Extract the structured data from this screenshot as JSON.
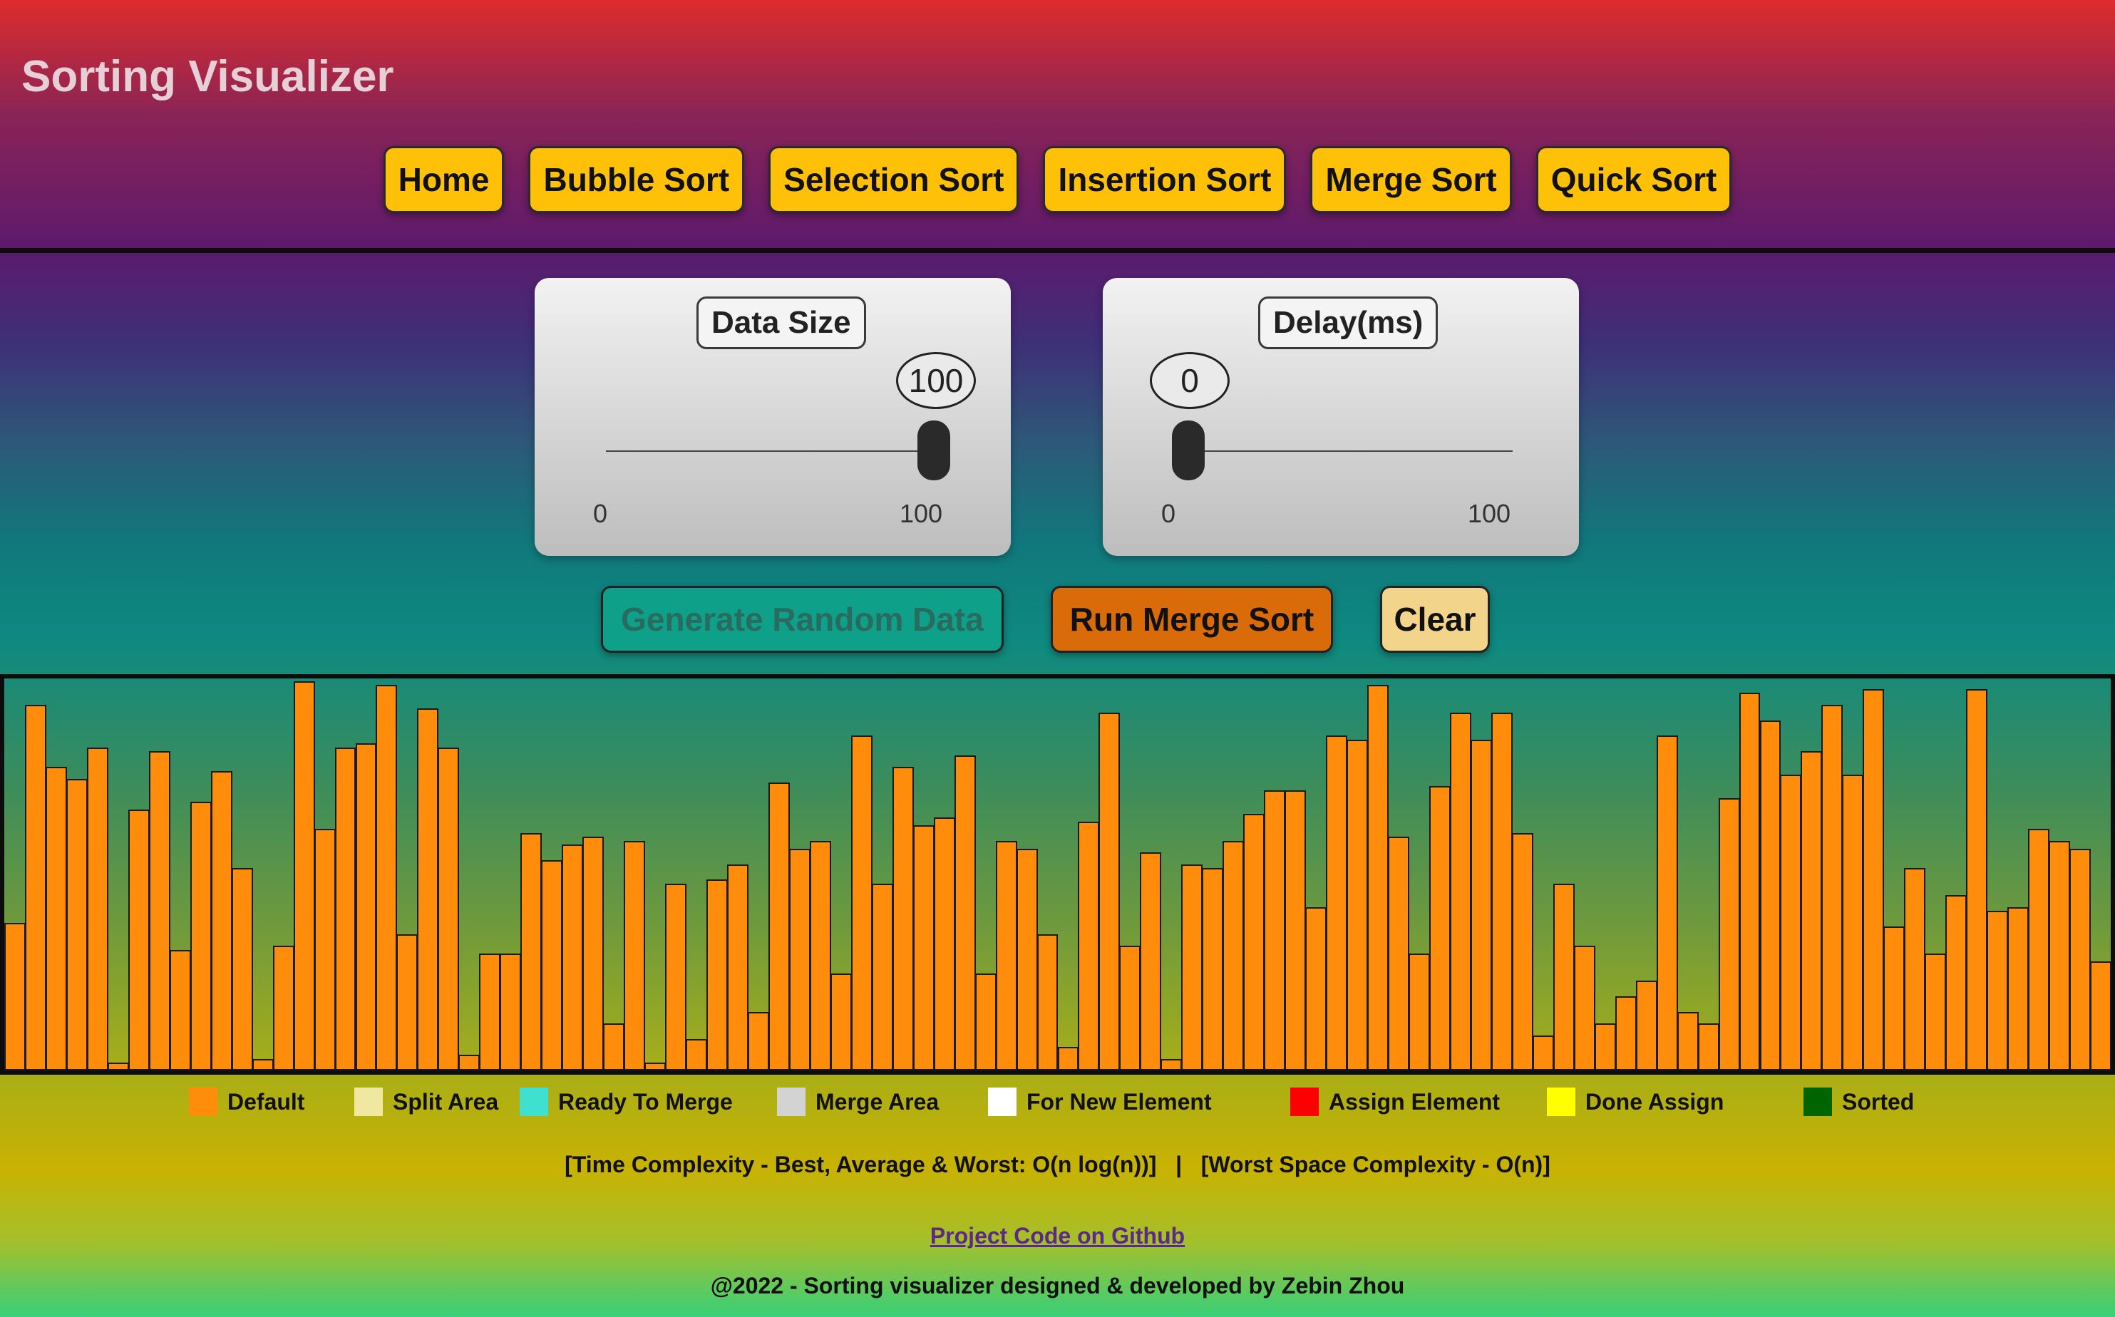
{
  "app": {
    "title": "Sorting Visualizer"
  },
  "nav": [
    {
      "label": "Home"
    },
    {
      "label": "Bubble Sort"
    },
    {
      "label": "Selection Sort"
    },
    {
      "label": "Insertion Sort"
    },
    {
      "label": "Merge Sort"
    },
    {
      "label": "Quick Sort"
    }
  ],
  "controls": {
    "data_size": {
      "label": "Data Size",
      "value": "100",
      "min": "0",
      "max": "100",
      "fraction": 1.0
    },
    "delay": {
      "label": "Delay(ms)",
      "value": "0",
      "min": "0",
      "max": "100",
      "fraction": 0.0
    }
  },
  "actions": {
    "generate": {
      "label": "Generate Random Data",
      "bg": "#0fa08a",
      "color": "#2a6b60"
    },
    "run": {
      "label": "Run Merge Sort",
      "bg": "#d96c08",
      "color": "#111111"
    },
    "clear": {
      "label": "Clear",
      "bg": "#f2d58a",
      "color": "#111111"
    }
  },
  "bars": {
    "color": "#ff8c0a",
    "values": [
      38,
      94,
      78,
      75,
      83,
      2,
      67,
      82,
      31,
      69,
      77,
      52,
      3,
      32,
      100,
      62,
      83,
      84,
      99,
      35,
      93,
      83,
      4,
      30,
      30,
      61,
      54,
      58,
      60,
      12,
      59,
      2,
      48,
      8,
      49,
      53,
      15,
      74,
      57,
      59,
      25,
      86,
      48,
      78,
      63,
      65,
      81,
      25,
      59,
      57,
      35,
      6,
      64,
      92,
      32,
      56,
      3,
      53,
      52,
      59,
      66,
      72,
      72,
      42,
      86,
      85,
      99,
      60,
      30,
      73,
      92,
      85,
      92,
      61,
      9,
      48,
      32,
      12,
      19,
      23,
      86,
      15,
      12,
      70,
      97,
      90,
      76,
      82,
      94,
      76,
      98,
      37,
      52,
      30,
      45,
      98,
      41,
      42,
      62,
      59,
      57,
      28
    ]
  },
  "legend": [
    {
      "label": "Default",
      "color": "#ff8c0a"
    },
    {
      "label": "Split Area",
      "color": "#f0e8a0"
    },
    {
      "label": "Ready To Merge",
      "color": "#40e0d0"
    },
    {
      "label": "Merge Area",
      "color": "#d3d3d3"
    },
    {
      "label": "For New Element",
      "color": "#ffffff"
    },
    {
      "label": "Assign Element",
      "color": "#ff0000"
    },
    {
      "label": "Done Assign",
      "color": "#ffff00"
    },
    {
      "label": "Sorted",
      "color": "#006400"
    }
  ],
  "complexity": "[Time Complexity - Best, Average & Worst: O(n log(n))]   |   [Worst Space Complexity - O(n)]",
  "link": {
    "label": "Project Code on Github"
  },
  "footer": {
    "text": "@2022 - Sorting visualizer designed & developed by Zebin Zhou"
  }
}
